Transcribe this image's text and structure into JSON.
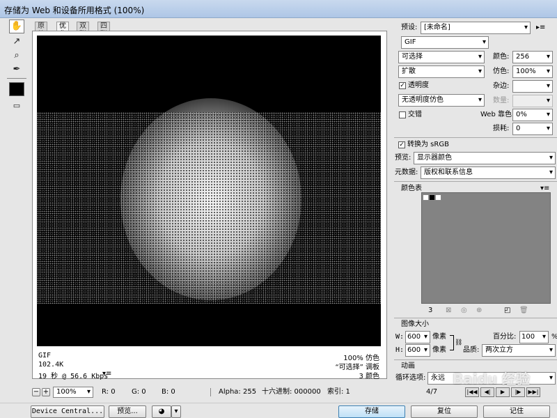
{
  "window": {
    "title": "存储为 Web 和设备所用格式 (100%)"
  },
  "tools": [
    {
      "icon": "hand-icon",
      "glyph": "✋"
    },
    {
      "icon": "slice-select-icon",
      "glyph": "↗"
    },
    {
      "icon": "zoom-icon",
      "glyph": "🔍"
    },
    {
      "icon": "eyedropper-icon",
      "glyph": "✒"
    }
  ],
  "tabs": [
    "原稿",
    "优化",
    "双联",
    "四联"
  ],
  "image_info": {
    "format": "GIF",
    "size": "102.4K",
    "time": "19 秒 @ 56.6 Kbps",
    "dither": "100% 仿色",
    "palette": "“可选择” 调板",
    "colors": "3 颜色"
  },
  "status": {
    "zoom": "100%",
    "r": "R: 0",
    "g": "G: 0",
    "b": "B: 0",
    "alpha": "Alpha: 255",
    "hex": "十六进制: 000000",
    "index": "索引: 1"
  },
  "settings": {
    "preset_label": "预设:",
    "preset_value": "[未命名]",
    "format": "GIF",
    "reduction": "可选择",
    "colors_label": "颜色:",
    "colors_value": "256",
    "dither_algo": "扩散",
    "dither_label": "仿色:",
    "dither_value": "100%",
    "transparency": "透明度",
    "matte_label": "杂边:",
    "matte_value": "",
    "trans_dither": "无透明度仿色",
    "amount_label": "数量:",
    "interlaced": "交错",
    "web_snap_label": "Web 靠色:",
    "web_snap_value": "0%",
    "lossy_label": "损耗:",
    "lossy_value": "0",
    "srgb": "转换为 sRGB",
    "preview_label": "预览:",
    "preview_value": "显示器颜色",
    "metadata_label": "元数据:",
    "metadata_value": "版权和联系信息"
  },
  "color_table": {
    "title": "颜色表",
    "count": "3"
  },
  "image_size": {
    "title": "图像大小",
    "w_label": "W:",
    "w_value": "600",
    "h_label": "H:",
    "h_value": "600",
    "unit": "像素",
    "percent_label": "百分比:",
    "percent_value": "100",
    "percent_unit": "%",
    "quality_label": "品质:",
    "quality_value": "两次立方"
  },
  "animation": {
    "title": "动画",
    "loop_label": "循环选项:",
    "loop_value": "永远",
    "frame": "4/7"
  },
  "buttons": {
    "device_central": "Device Central...",
    "preview": "预览...",
    "save": "存储",
    "reset": "复位",
    "remember": "记住"
  },
  "watermark": "Baidu 经验"
}
